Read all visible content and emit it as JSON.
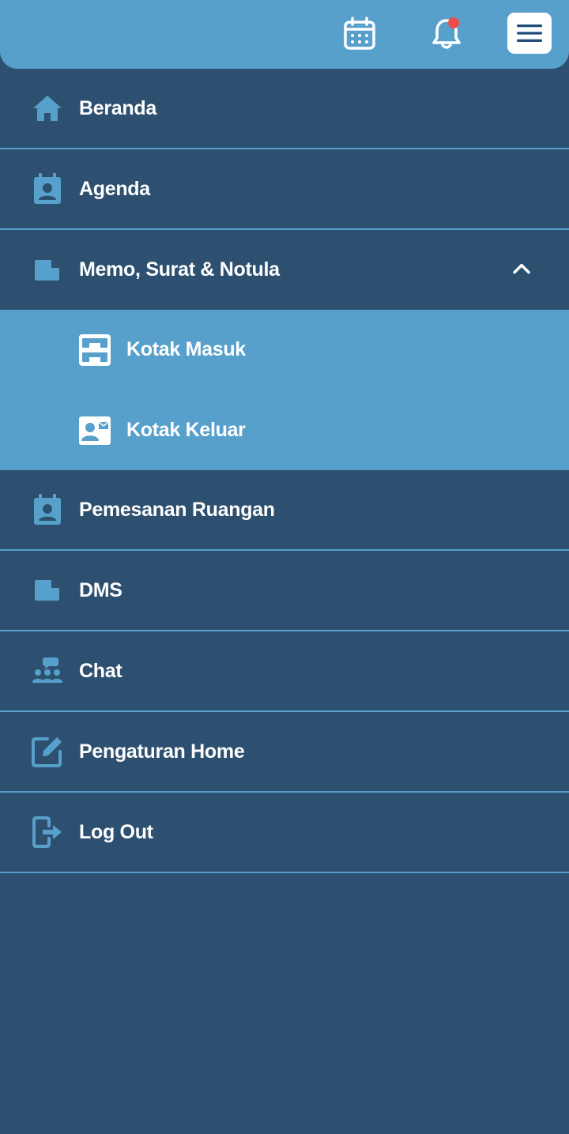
{
  "header": {
    "calendar_icon": "calendar-icon",
    "bell_icon": "bell-icon",
    "menu_icon": "hamburger-menu-icon"
  },
  "colors": {
    "header": "#57a0cc",
    "background": "#2e5070",
    "accent": "#57a0cc",
    "notification_dot": "#ee4b4b",
    "text": "#ffffff"
  },
  "nav": {
    "beranda": "Beranda",
    "agenda": "Agenda",
    "memo": "Memo, Surat & Notula",
    "memo_sub": {
      "kotak_masuk": "Kotak Masuk",
      "kotak_keluar": "Kotak Keluar"
    },
    "pemesanan": "Pemesanan Ruangan",
    "dms": "DMS",
    "chat": "Chat",
    "pengaturan": "Pengaturan Home",
    "logout": "Log Out"
  }
}
